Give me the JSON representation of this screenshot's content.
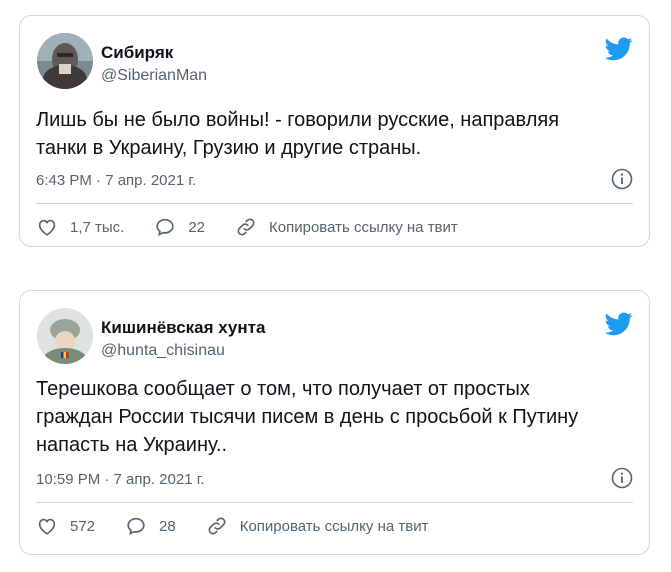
{
  "tweets": [
    {
      "author_name": "Сибиряк",
      "author_handle": "@SiberianMan",
      "text_lines": [
        "Лишь бы не было войны! - говорили русские, направляя",
        "танки в Украину, Грузию и другие страны."
      ],
      "timestamp": "6:43 PM · 7 апр. 2021 г.",
      "likes": "1,7 тыс.",
      "replies": "22",
      "copy_link_label": "Копировать ссылку на твит"
    },
    {
      "author_name": "Кишинёвская хунта",
      "author_handle": "@hunta_chisinau",
      "text_lines": [
        "Терешкова сообщает о том, что получает от простых",
        "граждан России тысячи писем в день с просьбой к Путину",
        "напасть на Украину.."
      ],
      "timestamp": "10:59 PM · 7 апр. 2021 г.",
      "likes": "572",
      "replies": "28",
      "copy_link_label": "Копировать ссылку на твит"
    }
  ],
  "colors": {
    "twitter_blue": "#1d9bf0",
    "secondary_text": "#536471",
    "border": "#cfd9de"
  },
  "icons": [
    "twitter-bird-icon",
    "info-icon",
    "heart-icon",
    "reply-icon",
    "link-icon"
  ]
}
